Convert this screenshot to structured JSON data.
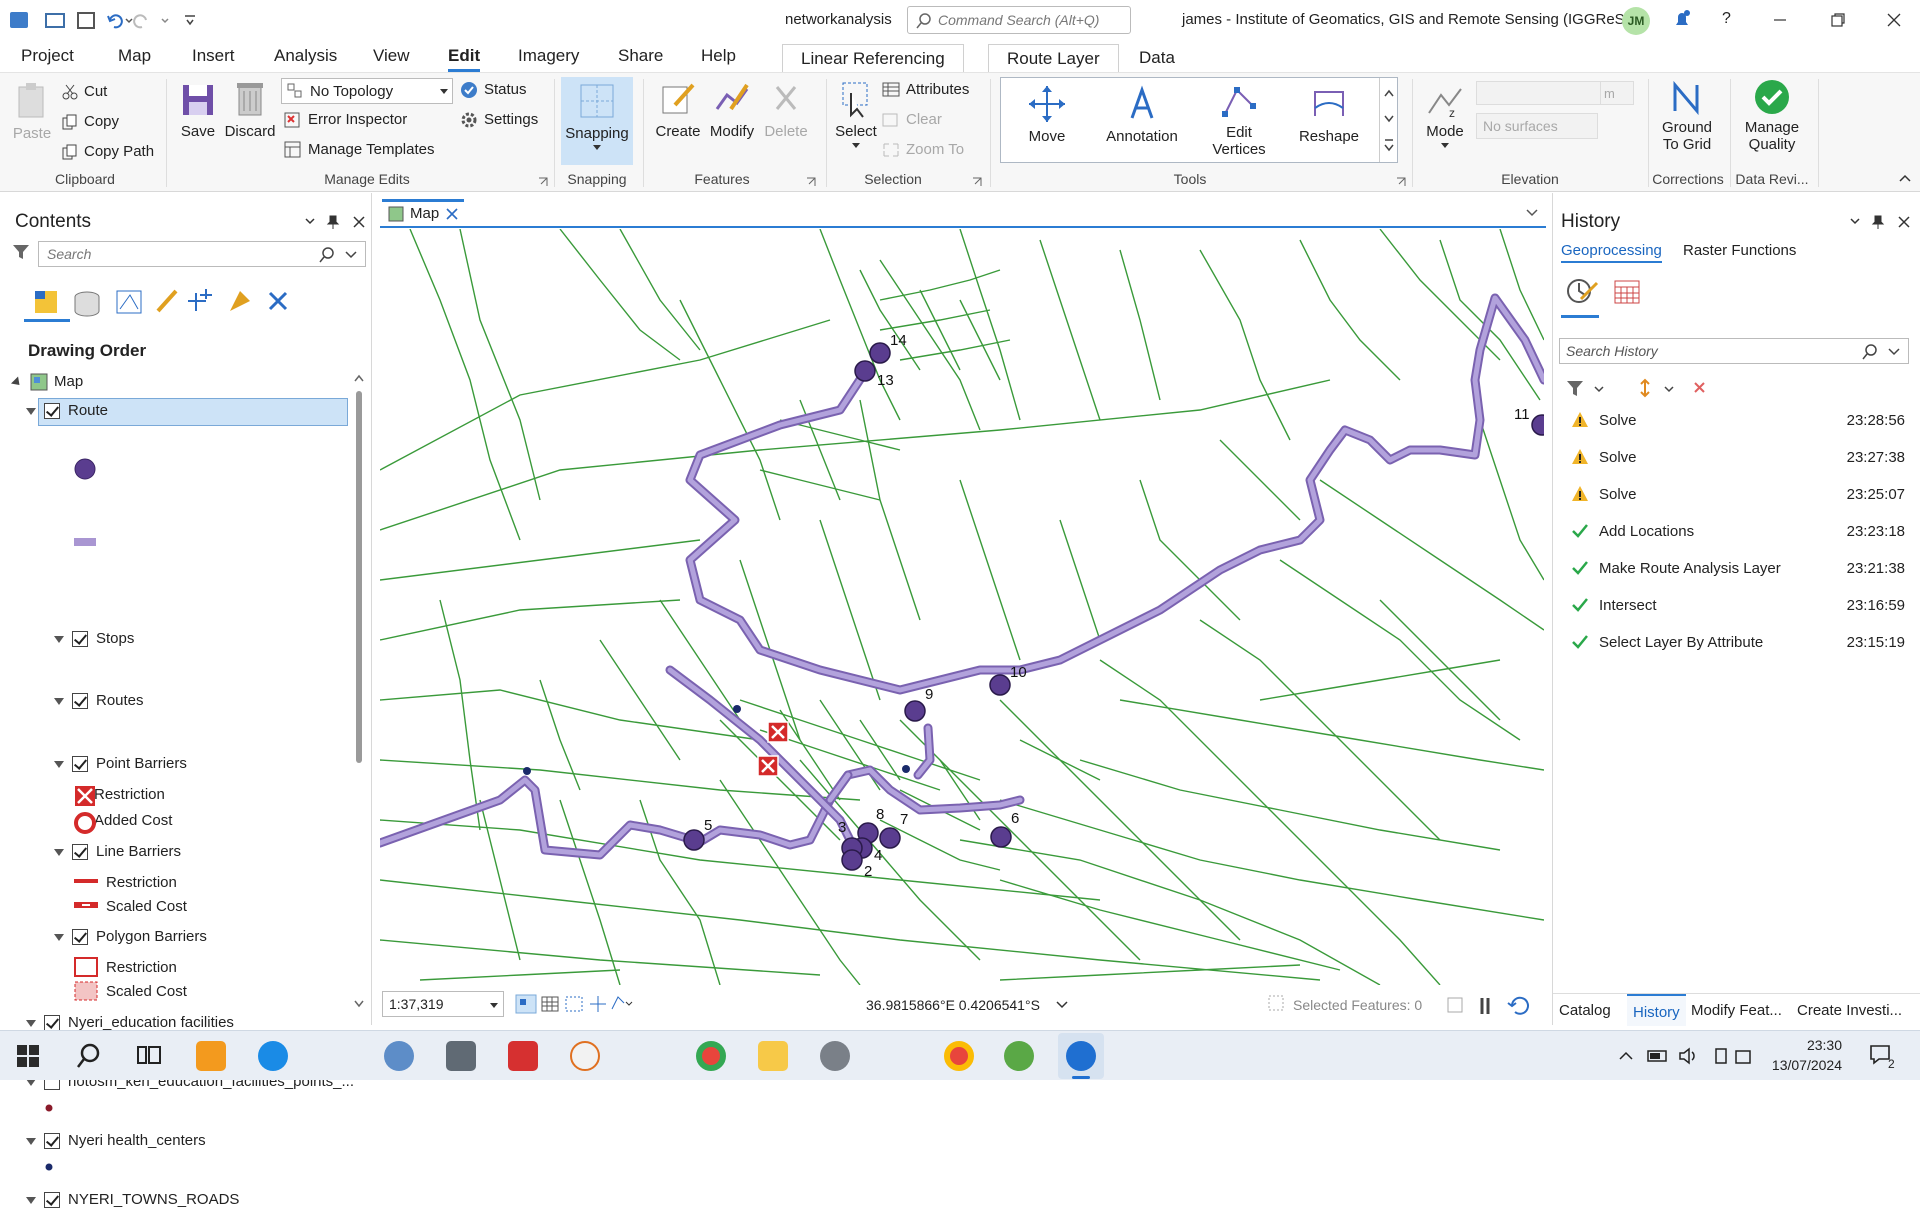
{
  "titlebar": {
    "project_name": "networkanalysis",
    "command_search_placeholder": "Command Search (Alt+Q)",
    "user_org": "james - Institute of Geomatics, GIS and Remote Sensing (IGGReS)",
    "user_initials": "JM",
    "help_label": "?"
  },
  "ribbon_tabs": [
    "Project",
    "Map",
    "Insert",
    "Analysis",
    "View",
    "Edit",
    "Imagery",
    "Share",
    "Help"
  ],
  "active_tab": "Edit",
  "contextual_tabs": [
    "Linear Referencing",
    "Route Layer",
    "Data"
  ],
  "ribbon": {
    "clipboard": {
      "paste": "Paste",
      "cut": "Cut",
      "copy": "Copy",
      "copy_path": "Copy Path",
      "label": "Clipboard"
    },
    "manage_edits": {
      "save": "Save",
      "discard": "Discard",
      "topology": "No Topology",
      "status": "Status",
      "error_inspector": "Error Inspector",
      "settings": "Settings",
      "manage_templates": "Manage Templates",
      "label": "Manage Edits"
    },
    "snapping": {
      "button": "Snapping",
      "label": "Snapping"
    },
    "features": {
      "create": "Create",
      "modify": "Modify",
      "delete": "Delete",
      "label": "Features"
    },
    "selection": {
      "select": "Select",
      "attributes": "Attributes",
      "clear": "Clear",
      "zoom_to": "Zoom To",
      "label": "Selection"
    },
    "tools": {
      "move": "Move",
      "annotation": "Annotation",
      "edit_vertices": "Edit Vertices",
      "reshape": "Reshape",
      "label": "Tools"
    },
    "elevation": {
      "mode": "Mode",
      "surface_placeholder": "No surfaces",
      "unit": "m",
      "label": "Elevation"
    },
    "corrections": {
      "ground_to_grid": "Ground To Grid",
      "label": "Corrections"
    },
    "data_reviewer": {
      "manage_quality": "Manage Quality",
      "label": "Data Revi..."
    }
  },
  "contents": {
    "title": "Contents",
    "search_placeholder": "Search",
    "drawing_order": "Drawing Order",
    "map_label": "Map",
    "layers": {
      "route": "Route",
      "stops": "Stops",
      "routes": "Routes",
      "point_barriers": "Point Barriers",
      "pb_restriction": "Restriction",
      "pb_added_cost": "Added Cost",
      "line_barriers": "Line Barriers",
      "lb_restriction": "Restriction",
      "lb_scaled_cost": "Scaled Cost",
      "polygon_barriers": "Polygon Barriers",
      "pg_restriction": "Restriction",
      "pg_scaled_cost": "Scaled Cost",
      "nyeri_education": "Nyeri_education facilities",
      "hotosm": "hotosm_ken_education_facilities_points_...",
      "nyeri_health": "Nyeri health_centers",
      "nyeri_roads": "NYERI_TOWNS_ROADS"
    }
  },
  "map": {
    "tab_label": "Map",
    "scale": "1:37,319",
    "coordinates": "36.9815866°E 0.4206541°S",
    "selected_features": "Selected Features: 0",
    "stop_labels": [
      "14",
      "13",
      "11",
      "10",
      "9",
      "8",
      "7",
      "6",
      "5",
      "4",
      "3",
      "2"
    ],
    "colors": {
      "road": "#3a9a3a",
      "route": "#9b84c8",
      "route_outline": "#7a62b0",
      "stop": "#5a3d8f",
      "barrier": "#d42a2a"
    }
  },
  "history": {
    "title": "History",
    "tabs": [
      "Geoprocessing",
      "Raster Functions"
    ],
    "search_placeholder": "Search History",
    "items": [
      {
        "name": "Solve",
        "time": "23:28:56",
        "status": "warning"
      },
      {
        "name": "Solve",
        "time": "23:27:38",
        "status": "warning"
      },
      {
        "name": "Solve",
        "time": "23:25:07",
        "status": "warning"
      },
      {
        "name": "Add Locations",
        "time": "23:23:18",
        "status": "success"
      },
      {
        "name": "Make Route Analysis Layer",
        "time": "23:21:38",
        "status": "success"
      },
      {
        "name": "Intersect",
        "time": "23:16:59",
        "status": "success"
      },
      {
        "name": "Select Layer By Attribute",
        "time": "23:15:19",
        "status": "success"
      }
    ],
    "bottom_tabs": [
      "Catalog",
      "History",
      "Modify Feat...",
      "Create Investi..."
    ]
  },
  "taskbar": {
    "time": "23:30",
    "date": "13/07/2024",
    "notif_count": "2"
  }
}
